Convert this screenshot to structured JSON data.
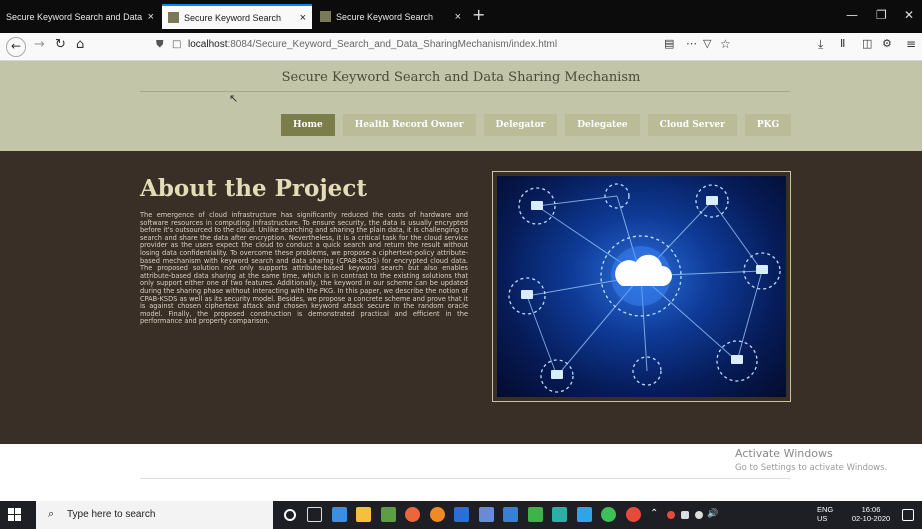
{
  "browser": {
    "tabs": [
      {
        "title": "Secure Keyword Search and Data Sh",
        "close": "×"
      },
      {
        "title": "Secure Keyword Search",
        "close": "×"
      },
      {
        "title": "Secure Keyword Search",
        "close": "×"
      }
    ],
    "new_tab": "+",
    "url_host": "localhost",
    "url_path": ":8084/Secure_Keyword_Search_and_Data_SharingMechanism/index.html"
  },
  "site": {
    "title": "Secure Keyword Search and Data Sharing Mechanism",
    "nav": [
      {
        "label": "Home",
        "active": true
      },
      {
        "label": "Health Record Owner",
        "active": false
      },
      {
        "label": "Delegator",
        "active": false
      },
      {
        "label": "Delegatee",
        "active": false
      },
      {
        "label": "Cloud Server",
        "active": false
      },
      {
        "label": "PKG",
        "active": false
      }
    ],
    "about_heading": "About the Project",
    "about_text": "The emergence of cloud infrastructure has significantly reduced the costs of hardware and software resources in computing infrastructure. To ensure security, the data is usually encrypted before it's outsourced to the cloud. Unlike searching and sharing the plain data, it is challenging to search and share the data after encryption. Nevertheless, it is a critical task for the cloud service provider as the users expect the cloud to conduct a quick search and return the result without losing data confidentiality. To overcome these problems, we propose a ciphertext-policy attribute-based mechanism with keyword search and data sharing (CPAB-KSDS) for encrypted cloud data. The proposed solution not only supports attribute-based keyword search but also enables attribute-based data sharing at the same time, which is in contrast to the existing solutions that only support either one of two features. Additionally, the keyword in our scheme can be updated during the sharing phase without interacting with the PKG. In this paper, we describe the notion of CPAB-KSDS as well as its security model. Besides, we propose a concrete scheme and prove that it is against chosen ciphertext attack and chosen keyword attack secure in the random oracle model. Finally, the proposed construction is demonstrated practical and efficient in the performance and property comparison."
  },
  "watermark": {
    "line1": "Activate Windows",
    "line2": "Go to Settings to activate Windows."
  },
  "taskbar": {
    "search_placeholder": "Type here to search",
    "lang1": "ENG",
    "lang2": "US",
    "time": "16:06",
    "date": "02-10-2020"
  },
  "colors": {
    "header_bg": "#c3c5a8",
    "content_bg": "#3a2f26",
    "nav_active": "#7b7d4b",
    "nav_inactive": "#b9bc97"
  }
}
